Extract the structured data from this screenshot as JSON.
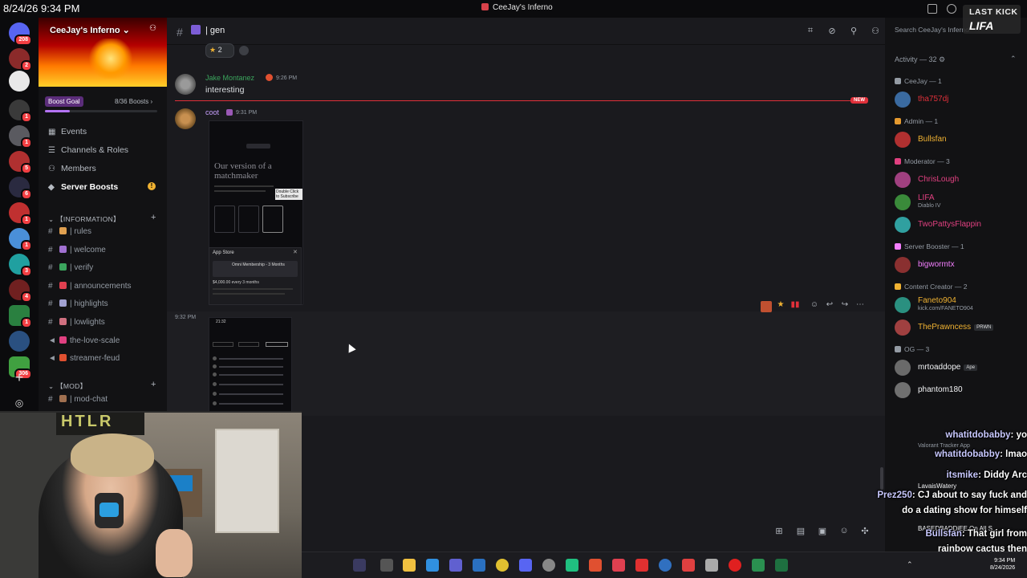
{
  "titlebar": {
    "timestamp": "8/24/26 9:34 PM",
    "window_title": "CeeJay's Inferno"
  },
  "overlay_logo": {
    "line1": "LAST KICK",
    "line2": "LIFA"
  },
  "server_rail": {
    "badges": [
      "208",
      "2",
      "",
      "1",
      "1",
      "5",
      "6",
      "1",
      "1",
      "3",
      "4",
      "1",
      "1",
      "",
      "",
      "306"
    ]
  },
  "sidebar": {
    "server_name": "CeeJay's Inferno",
    "boost_goal_label": "Boost Goal",
    "boost_count": "8/36 Boosts",
    "menu": {
      "events": "Events",
      "channels_roles": "Channels & Roles",
      "members": "Members",
      "server_boosts": "Server Boosts",
      "warn": "!"
    },
    "category_info": "【INFORMATION】",
    "channels_info": [
      {
        "name": "| rules",
        "color": "#e0a050"
      },
      {
        "name": "| welcome",
        "color": "#a070d0"
      },
      {
        "name": "| verify",
        "color": "#3ba55d"
      },
      {
        "name": "| announcements",
        "color": "#e04050"
      },
      {
        "name": "| highlights",
        "color": "#a0a0d0"
      },
      {
        "name": "| lowlights",
        "color": "#d07080"
      },
      {
        "name": "the-love-scale",
        "color": "#e04080"
      },
      {
        "name": "streamer-feud",
        "color": "#e05030"
      }
    ],
    "category_mod": "【MOD】",
    "channels_mod": [
      {
        "name": "| mod-chat",
        "color": "#a07050"
      }
    ]
  },
  "channel": {
    "hash": "#",
    "name": "| gen",
    "search_placeholder": "Search CeeJay's Inferno"
  },
  "messages": {
    "reaction_count": "2",
    "m1": {
      "author": "Jake Montanez",
      "time": "9:26 PM",
      "text": "interesting"
    },
    "new_label": "NEW",
    "m2": {
      "author": "coot",
      "time": "9:31 PM"
    },
    "m3": {
      "time": "9:32 PM"
    },
    "shot1": {
      "headline": "Our version of a matchmaker",
      "tip": "Double Click to Subscribe",
      "appstore_title": "App Store",
      "appstore_close": "✕",
      "membership": "Omni Membership - 3 Months",
      "price": "$4,000.00 every 3 months"
    },
    "shot2": {
      "clock": "21:32"
    }
  },
  "members": {
    "activity_header": "Activity — 32",
    "groups": [
      {
        "label": "CeeJay — 1",
        "color": "#949ba4",
        "members": [
          {
            "name": "tha757dj",
            "color": "#e0303a",
            "sub": ""
          }
        ]
      },
      {
        "label": "Admin — 1",
        "color": "#e59a2f",
        "members": [
          {
            "name": "Bullsfan",
            "color": "#f0b232",
            "sub": ""
          }
        ]
      },
      {
        "label": "Moderator — 3",
        "color": "#e04080",
        "members": [
          {
            "name": "ChrisLough",
            "color": "#e04080",
            "sub": ""
          },
          {
            "name": "LIFA",
            "color": "#e04080",
            "sub": "Diablo IV"
          },
          {
            "name": "TwoPattysFlappin",
            "color": "#e04080",
            "sub": ""
          }
        ]
      },
      {
        "label": "Server Booster — 1",
        "color": "#f47fff",
        "members": [
          {
            "name": "bigwormtx",
            "color": "#f47fff",
            "sub": ""
          }
        ]
      },
      {
        "label": "Content Creator — 2",
        "color": "#f0b232",
        "members": [
          {
            "name": "Faneto904",
            "color": "#f0b232",
            "sub": "kick.com/FANETO904"
          },
          {
            "name": "ThePrawncess",
            "color": "#f0b232",
            "sub": "",
            "tag": "PRWN"
          }
        ]
      },
      {
        "label": "OG — 3",
        "color": "#949ba4",
        "members": [
          {
            "name": "mrtoaddope",
            "color": "#f2f3f5",
            "sub": "",
            "tag": "Ape"
          },
          {
            "name": "phantom180",
            "color": "#f2f3f5",
            "sub": ""
          }
        ]
      }
    ],
    "partial_sub": "Valorant Tracker App",
    "partial_name": "LavaisWatery",
    "partial_name2": "BASEDBADDiEE On All S..."
  },
  "stream_chat": [
    {
      "user": "whatitdobabby",
      "text": ": yo"
    },
    {
      "user": "whatitdobabby",
      "text": ": lmao"
    },
    {
      "user": "itsmike",
      "text": ": Diddy Arc"
    },
    {
      "user": "Prez250",
      "text": ": CJ about to say fuck and"
    },
    {
      "user": "",
      "text": "do a dating show for himself"
    },
    {
      "user": "Bullsfan",
      "text": ": That girl from"
    },
    {
      "user": "",
      "text": "rainbow cactus then"
    }
  ],
  "webcam": {
    "logo_text": "HTLR"
  },
  "taskbar": {
    "time": "9:34 PM",
    "date": "8/24/2026"
  }
}
